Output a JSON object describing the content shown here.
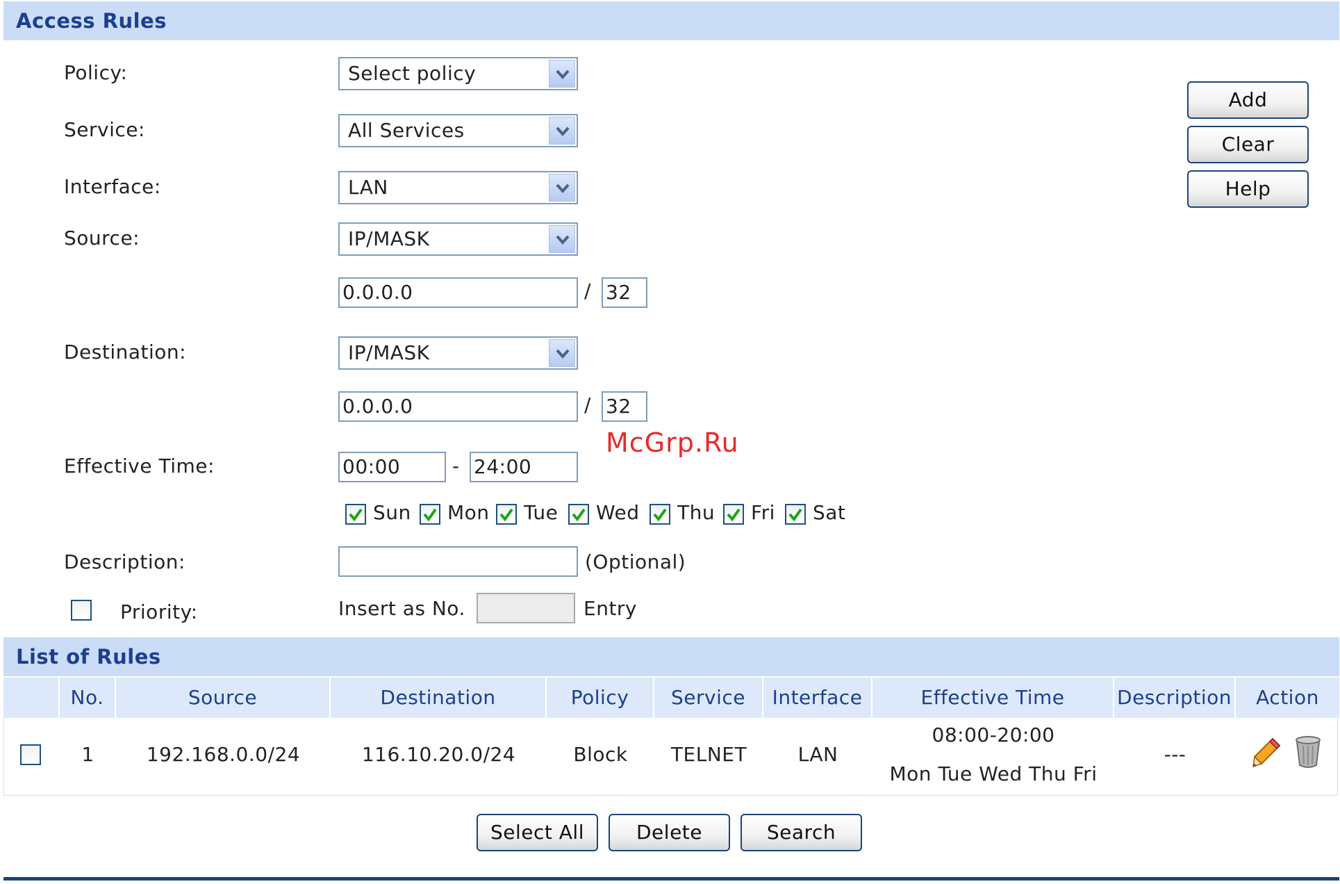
{
  "access_rules": {
    "title": "Access Rules",
    "policy": {
      "label": "Policy:",
      "value": "Select policy"
    },
    "service": {
      "label": "Service:",
      "value": "All Services"
    },
    "interface": {
      "label": "Interface:",
      "value": "LAN"
    },
    "source": {
      "label": "Source:",
      "type": "IP/MASK",
      "ip": "0.0.0.0",
      "mask": "32"
    },
    "destination": {
      "label": "Destination:",
      "type": "IP/MASK",
      "ip": "0.0.0.0",
      "mask": "32"
    },
    "effective_time": {
      "label": "Effective Time:",
      "start": "00:00",
      "end": "24:00",
      "separator": "-"
    },
    "days": [
      {
        "label": "Sun",
        "checked": true
      },
      {
        "label": "Mon",
        "checked": true
      },
      {
        "label": "Tue",
        "checked": true
      },
      {
        "label": "Wed",
        "checked": true
      },
      {
        "label": "Thu",
        "checked": true
      },
      {
        "label": "Fri",
        "checked": true
      },
      {
        "label": "Sat",
        "checked": true
      }
    ],
    "description": {
      "label": "Description:",
      "value": "",
      "hint": "(Optional)"
    },
    "priority": {
      "label": "Priority:",
      "checked": false,
      "insert_prefix": "Insert as No.",
      "value": "",
      "insert_suffix": "Entry"
    },
    "buttons": {
      "add": "Add",
      "clear": "Clear",
      "help": "Help"
    },
    "slash": "/"
  },
  "watermark": "McGrp.Ru",
  "list_of_rules": {
    "title": "List of Rules",
    "columns": [
      "No.",
      "Source",
      "Destination",
      "Policy",
      "Service",
      "Interface",
      "Effective Time",
      "Description",
      "Action"
    ],
    "rows": [
      {
        "no": "1",
        "source": "192.168.0.0/24",
        "destination": "116.10.20.0/24",
        "policy": "Block",
        "service": "TELNET",
        "interface": "LAN",
        "time": "08:00-20:00",
        "days": "Mon Tue Wed Thu Fri",
        "description": "---",
        "checked": false,
        "actions": [
          "edit-icon",
          "delete-icon"
        ]
      }
    ],
    "buttons": {
      "select_all": "Select All",
      "delete": "Delete",
      "search": "Search"
    }
  },
  "colors": {
    "header_bg": "#cadcf6",
    "header_text": "#1c3f8f",
    "bottom_rule": "#1c4476"
  }
}
